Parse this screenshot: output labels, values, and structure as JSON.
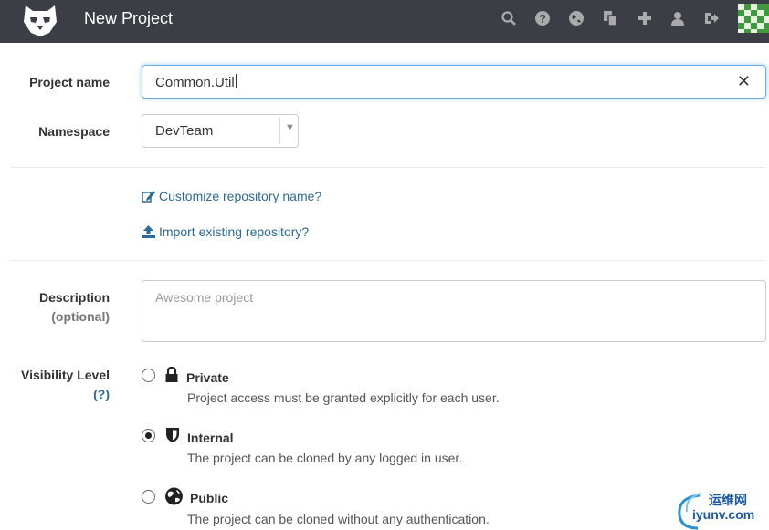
{
  "header": {
    "title": "New Project",
    "icons": [
      "search-icon",
      "help-icon",
      "globe-icon",
      "copy-icon",
      "plus-icon",
      "user-icon",
      "sign-out-icon"
    ],
    "bg_color": "#3b3e44"
  },
  "form": {
    "project_name": {
      "label": "Project name",
      "value": "Common.Util"
    },
    "namespace": {
      "label": "Namespace",
      "selected": "DevTeam"
    },
    "links": {
      "customize": "Customize repository name?",
      "import": "Import existing repository?"
    },
    "description": {
      "label": "Description",
      "sub_label": "(optional)",
      "placeholder": "Awesome project"
    },
    "visibility": {
      "label": "Visibility Level",
      "help": "(?)",
      "selected": "Internal",
      "options": [
        {
          "title": "Private",
          "desc": "Project access must be granted explicitly for each user.",
          "icon": "lock-icon"
        },
        {
          "title": "Internal",
          "desc": "The project can be cloned by any logged in user.",
          "icon": "shield-icon"
        },
        {
          "title": "Public",
          "desc": "The project can be cloned without any authentication.",
          "icon": "globe-icon"
        }
      ]
    }
  },
  "watermark": {
    "line1": "运维网",
    "line2": "iyunv.com"
  },
  "colors": {
    "link": "#2c6a97",
    "focus": "#66afe9"
  }
}
